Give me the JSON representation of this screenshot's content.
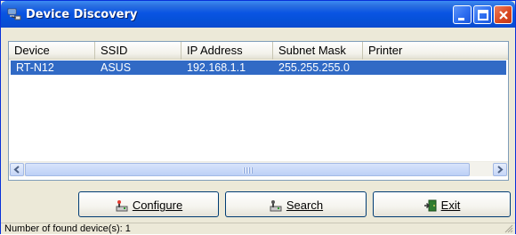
{
  "window": {
    "title": "Device Discovery"
  },
  "list": {
    "columns": [
      "Device",
      "SSID",
      "IP Address",
      "Subnet Mask",
      "Printer"
    ],
    "rows": [
      {
        "device": "RT-N12",
        "ssid": "ASUS",
        "ip": "192.168.1.1",
        "mask": "255.255.255.0",
        "printer": ""
      }
    ]
  },
  "buttons": {
    "configure": "Configure",
    "search": "Search",
    "exit": "Exit"
  },
  "status": {
    "text": "Number of found device(s): 1"
  },
  "colors": {
    "titlebar": "#0a54e3",
    "selection": "#316ac5",
    "face": "#ece9d8"
  }
}
